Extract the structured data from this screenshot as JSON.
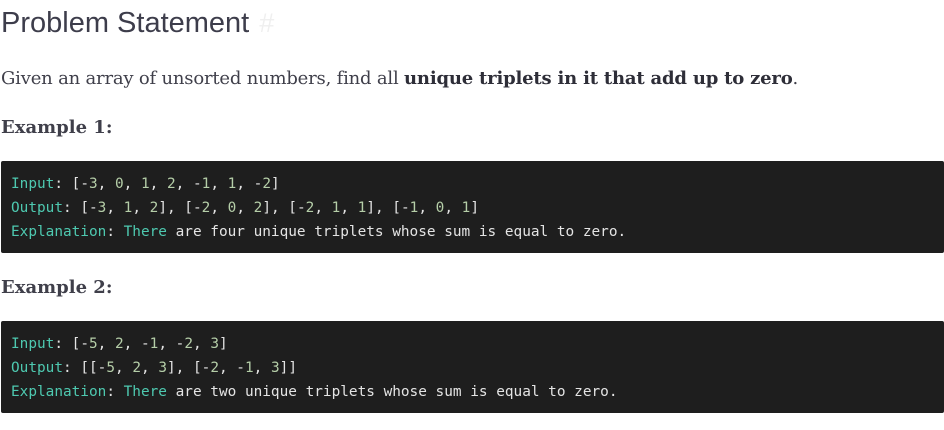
{
  "heading": {
    "title": "Problem Statement",
    "anchor": "#"
  },
  "intro": {
    "prefix": "Given an array of unsorted numbers, find all ",
    "bold": "unique triplets in it that add up to zero",
    "suffix": "."
  },
  "examples": [
    {
      "title": "Example 1:",
      "input_label": "Input",
      "input_value": "[-3, 0, 1, 2, -1, 1, -2]",
      "output_label": "Output",
      "output_value": "[-3, 1, 2], [-2, 0, 2], [-2, 1, 1], [-1, 0, 1]",
      "explanation_label": "Explanation",
      "explanation_first_word": "There",
      "explanation_rest": " are four unique triplets whose sum is equal to zero."
    },
    {
      "title": "Example 2:",
      "input_label": "Input",
      "input_value": "[-5, 2, -1, -2, 3]",
      "output_label": "Output",
      "output_value": "[[-5, 2, 3], [-2, -1, 3]]",
      "explanation_label": "Explanation",
      "explanation_first_word": "There",
      "explanation_rest": " are two unique triplets whose sum is equal to zero."
    }
  ],
  "colors": {
    "code_background": "#1e1e1e",
    "code_keyword": "#4ec9b0",
    "code_number": "#b5cea8",
    "code_text": "#e4e4e4"
  }
}
